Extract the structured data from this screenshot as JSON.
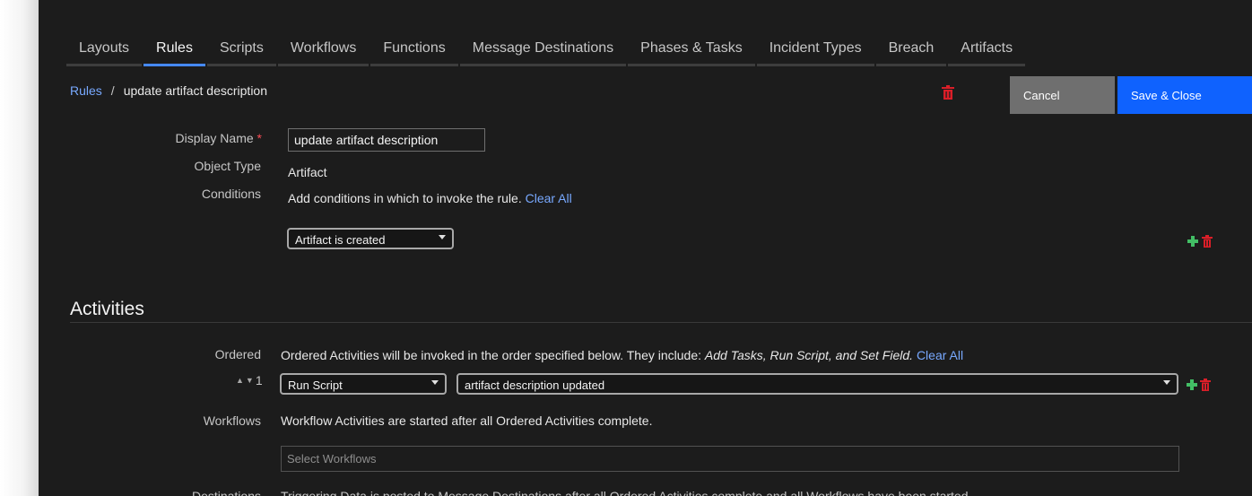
{
  "tabs": [
    {
      "label": "Layouts",
      "active": false
    },
    {
      "label": "Rules",
      "active": true
    },
    {
      "label": "Scripts",
      "active": false
    },
    {
      "label": "Workflows",
      "active": false
    },
    {
      "label": "Functions",
      "active": false
    },
    {
      "label": "Message Destinations",
      "active": false
    },
    {
      "label": "Phases & Tasks",
      "active": false
    },
    {
      "label": "Incident Types",
      "active": false
    },
    {
      "label": "Breach",
      "active": false
    },
    {
      "label": "Artifacts",
      "active": false
    }
  ],
  "breadcrumb": {
    "root": "Rules",
    "separator": "/",
    "current": "update artifact description"
  },
  "actions": {
    "cancel_label": "Cancel",
    "save_label": "Save & Close"
  },
  "form": {
    "display_name_label": "Display Name",
    "required_marker": "*",
    "display_name_value": "update artifact description",
    "object_type_label": "Object Type",
    "object_type_value": "Artifact",
    "conditions_label": "Conditions",
    "conditions_text": "Add conditions in which to invoke the rule.",
    "clear_all": "Clear All",
    "condition_select": "Artifact is created"
  },
  "activities": {
    "title": "Activities",
    "ordered_label": "Ordered",
    "ordered_text_prefix": "Ordered Activities will be invoked in the order specified below. They include: ",
    "ordered_text_italic": "Add Tasks, Run Script, and Set Field.",
    "clear_all": "Clear All",
    "row_number": "1",
    "activity_type": "Run Script",
    "activity_value": "artifact description updated",
    "workflows_label": "Workflows",
    "workflows_text": "Workflow Activities are started after all Ordered Activities complete.",
    "workflows_placeholder": "Select Workflows",
    "destinations_label": "Destinations",
    "destinations_text": "Triggering Data is posted to Message Destinations after all Ordered Activities complete and all Workflows have been started."
  },
  "colors": {
    "accent": "#0f62fe",
    "link": "#78a9ff",
    "add": "#42be65",
    "delete": "#da1e28"
  },
  "icons": {
    "trash": "trash-icon",
    "add": "plus-icon",
    "caret": "chevron-down-icon"
  }
}
